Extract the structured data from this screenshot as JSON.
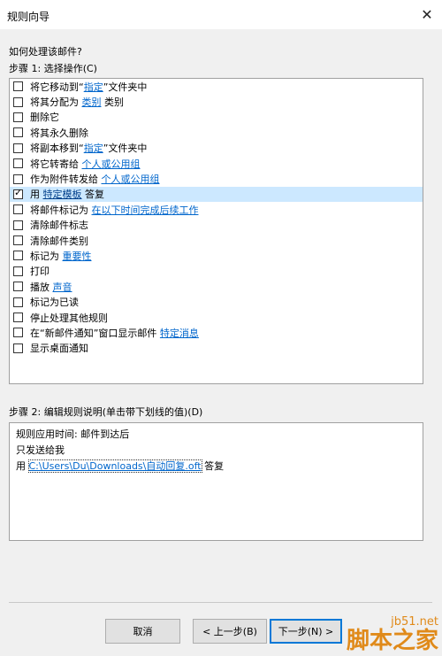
{
  "window": {
    "title": "规则向导",
    "close_glyph": "✕"
  },
  "question": "如何处理该邮件?",
  "step1_label": "步骤 1: 选择操作(C)",
  "actions": [
    {
      "checked": false,
      "parts": [
        {
          "text": "将它移动到“"
        },
        {
          "text": "指定",
          "link": true
        },
        {
          "text": "”文件夹中"
        }
      ]
    },
    {
      "checked": false,
      "parts": [
        {
          "text": "将其分配为 "
        },
        {
          "text": "类别",
          "link": true
        },
        {
          "text": " 类别"
        }
      ]
    },
    {
      "checked": false,
      "parts": [
        {
          "text": "删除它"
        }
      ]
    },
    {
      "checked": false,
      "parts": [
        {
          "text": "将其永久删除"
        }
      ]
    },
    {
      "checked": false,
      "parts": [
        {
          "text": "将副本移到“"
        },
        {
          "text": "指定",
          "link": true
        },
        {
          "text": "”文件夹中"
        }
      ]
    },
    {
      "checked": false,
      "parts": [
        {
          "text": "将它转寄给 "
        },
        {
          "text": "个人或公用组",
          "link": true
        }
      ]
    },
    {
      "checked": false,
      "parts": [
        {
          "text": "作为附件转发给 "
        },
        {
          "text": "个人或公用组",
          "link": true
        }
      ]
    },
    {
      "checked": true,
      "selected": true,
      "parts": [
        {
          "text": "用 "
        },
        {
          "text": "特定模板",
          "link": true,
          "dark": true
        },
        {
          "text": " 答复"
        }
      ]
    },
    {
      "checked": false,
      "parts": [
        {
          "text": "将邮件标记为 "
        },
        {
          "text": "在以下时间完成后续工作",
          "link": true
        }
      ]
    },
    {
      "checked": false,
      "parts": [
        {
          "text": "清除邮件标志"
        }
      ]
    },
    {
      "checked": false,
      "parts": [
        {
          "text": "清除邮件类别"
        }
      ]
    },
    {
      "checked": false,
      "parts": [
        {
          "text": "标记为 "
        },
        {
          "text": "重要性",
          "link": true
        }
      ]
    },
    {
      "checked": false,
      "parts": [
        {
          "text": "打印"
        }
      ]
    },
    {
      "checked": false,
      "parts": [
        {
          "text": "播放 "
        },
        {
          "text": "声音",
          "link": true
        }
      ]
    },
    {
      "checked": false,
      "parts": [
        {
          "text": "标记为已读"
        }
      ]
    },
    {
      "checked": false,
      "parts": [
        {
          "text": "停止处理其他规则"
        }
      ]
    },
    {
      "checked": false,
      "parts": [
        {
          "text": "在“新邮件通知”窗口显示邮件 "
        },
        {
          "text": "特定消息",
          "link": true
        }
      ]
    },
    {
      "checked": false,
      "parts": [
        {
          "text": "显示桌面通知"
        }
      ]
    }
  ],
  "step2_label": "步骤 2: 编辑规则说明(单击带下划线的值)(D)",
  "description": {
    "line1": "规则应用时间: 邮件到达后",
    "line2": "只发送给我",
    "line3_prefix": "用 ",
    "line3_link": "C:\\Users\\Du\\Downloads\\自动回复.oft",
    "line3_suffix": " 答复"
  },
  "buttons": {
    "cancel": "取消",
    "back": "< 上一步(B)",
    "next": "下一步(N) >"
  },
  "watermark": {
    "site": "jb51.net",
    "brand": "脚本之家"
  },
  "colors": {
    "link": "#0066cc",
    "selected_row": "#cce8ff",
    "watermark": "#e08a1a"
  }
}
